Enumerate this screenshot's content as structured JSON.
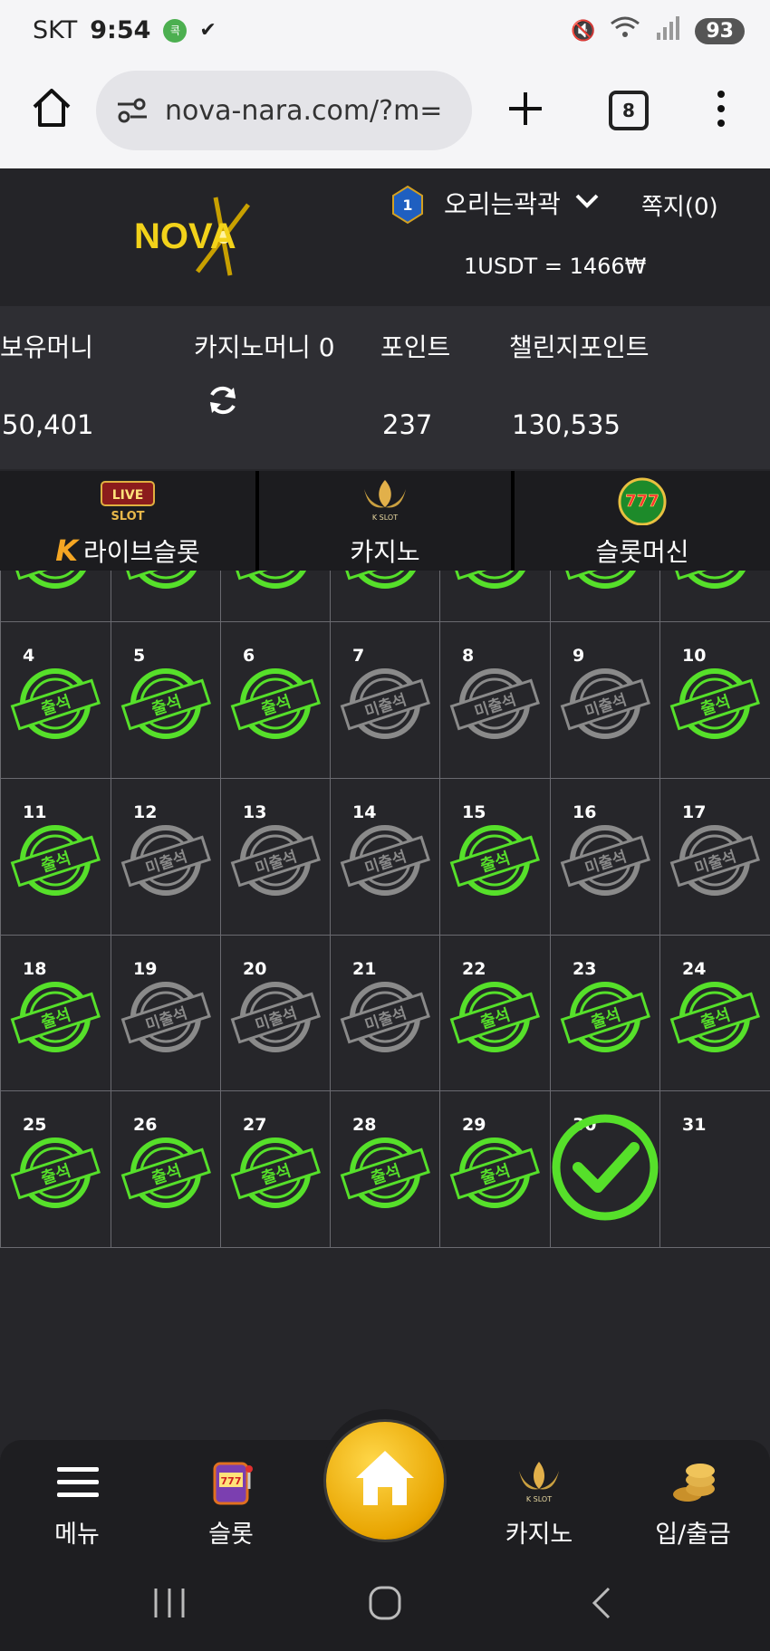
{
  "status_bar": {
    "carrier": "SKT",
    "time": "9:54",
    "app_badge": "콕",
    "battery": "93"
  },
  "browser": {
    "url": "nova-nara.com/?m=",
    "tab_count": "8"
  },
  "header": {
    "logo_text": "NOVA",
    "level": "1",
    "username": "오리는곽곽",
    "messages": "쪽지(0)",
    "rate": "1USDT = 1466₩"
  },
  "balances": [
    {
      "label": "보유머니",
      "value": "50,401"
    },
    {
      "label": "카지노머니 0",
      "value": ""
    },
    {
      "label": "포인트",
      "value": "237"
    },
    {
      "label": "챌린지포인트",
      "value": "130,535"
    }
  ],
  "categories": [
    {
      "label": "라이브슬롯",
      "icon": "live-slot-icon",
      "icon_text": "LIVE SLOT"
    },
    {
      "label": "카지노",
      "icon": "k-slot-icon",
      "icon_text": "K SLOT"
    },
    {
      "label": "슬롯머신",
      "icon": "777-slots-icon",
      "icon_text": "777"
    }
  ],
  "attendance": {
    "attended_label": "출석",
    "absent_label": "미출석",
    "weeks": [
      [
        {
          "day": "",
          "status": "attended"
        },
        {
          "day": "",
          "status": "attended"
        },
        {
          "day": "",
          "status": "attended"
        },
        {
          "day": "",
          "status": "attended"
        },
        {
          "day": "",
          "status": "attended"
        },
        {
          "day": "",
          "status": "attended"
        },
        {
          "day": "",
          "status": "attended"
        }
      ],
      [
        {
          "day": "4",
          "status": "attended"
        },
        {
          "day": "5",
          "status": "attended"
        },
        {
          "day": "6",
          "status": "attended"
        },
        {
          "day": "7",
          "status": "absent"
        },
        {
          "day": "8",
          "status": "absent"
        },
        {
          "day": "9",
          "status": "absent"
        },
        {
          "day": "10",
          "status": "attended"
        }
      ],
      [
        {
          "day": "11",
          "status": "attended"
        },
        {
          "day": "12",
          "status": "absent"
        },
        {
          "day": "13",
          "status": "absent"
        },
        {
          "day": "14",
          "status": "absent"
        },
        {
          "day": "15",
          "status": "attended"
        },
        {
          "day": "16",
          "status": "absent"
        },
        {
          "day": "17",
          "status": "absent"
        }
      ],
      [
        {
          "day": "18",
          "status": "attended"
        },
        {
          "day": "19",
          "status": "absent"
        },
        {
          "day": "20",
          "status": "absent"
        },
        {
          "day": "21",
          "status": "absent"
        },
        {
          "day": "22",
          "status": "attended"
        },
        {
          "day": "23",
          "status": "attended"
        },
        {
          "day": "24",
          "status": "attended"
        }
      ],
      [
        {
          "day": "25",
          "status": "attended"
        },
        {
          "day": "26",
          "status": "attended"
        },
        {
          "day": "27",
          "status": "attended"
        },
        {
          "day": "28",
          "status": "attended"
        },
        {
          "day": "29",
          "status": "attended"
        },
        {
          "day": "30",
          "status": "today"
        },
        {
          "day": "31",
          "status": "none"
        }
      ]
    ]
  },
  "bottom_nav": [
    {
      "label": "메뉴",
      "icon": "hamburger-icon"
    },
    {
      "label": "슬롯",
      "icon": "slot-machine-icon"
    },
    {
      "label": "",
      "icon": "home-icon"
    },
    {
      "label": "카지노",
      "icon": "k-slot-icon"
    },
    {
      "label": "입/출금",
      "icon": "coins-icon"
    }
  ],
  "colors": {
    "attended": "#56e02a",
    "absent": "#8a8a8a",
    "accent": "#f0b800",
    "background": "#26262a"
  }
}
